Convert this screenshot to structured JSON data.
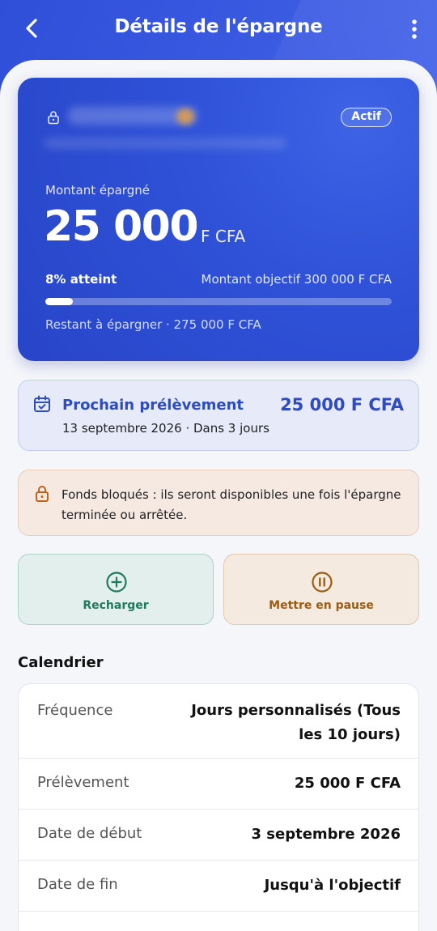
{
  "header": {
    "title": "Détails de l'épargne",
    "back_icon": "chevron-left-icon",
    "more_icon": "more-vertical-icon"
  },
  "savings_card": {
    "status": "Actif",
    "saved_label": "Montant épargné",
    "saved_amount": "25 000",
    "currency": "F CFA",
    "progress_label": "8% atteint",
    "progress_fraction": 0.08,
    "goal_text": "Montant objectif 300 000  F CFA",
    "remaining_text": "Restant à épargner · 275 000  F CFA"
  },
  "next_debit": {
    "title": "Prochain prélèvement",
    "amount": "25 000  F CFA",
    "date": "13 septembre 2026 · Dans 3 jours"
  },
  "locked_notice": {
    "text": "Fonds bloqués : ils seront disponibles une fois l'épargne terminée ou arrêtée."
  },
  "actions": {
    "recharge_label": "Recharger",
    "pause_label": "Mettre en pause"
  },
  "calendar": {
    "title": "Calendrier",
    "rows": [
      {
        "key": "Fréquence",
        "value": "Jours personnalisés (Tous les 10 jours)"
      },
      {
        "key": "Prélèvement",
        "value": "25 000  F CFA"
      },
      {
        "key": "Date de début",
        "value": "3 septembre 2026"
      },
      {
        "key": "Date de fin",
        "value": "Jusqu'à l'objectif"
      }
    ]
  },
  "colors": {
    "primary": "#2f52d8",
    "recharge": "#1f7a5e",
    "pause": "#9b5d14",
    "warning": "#c0621c"
  }
}
